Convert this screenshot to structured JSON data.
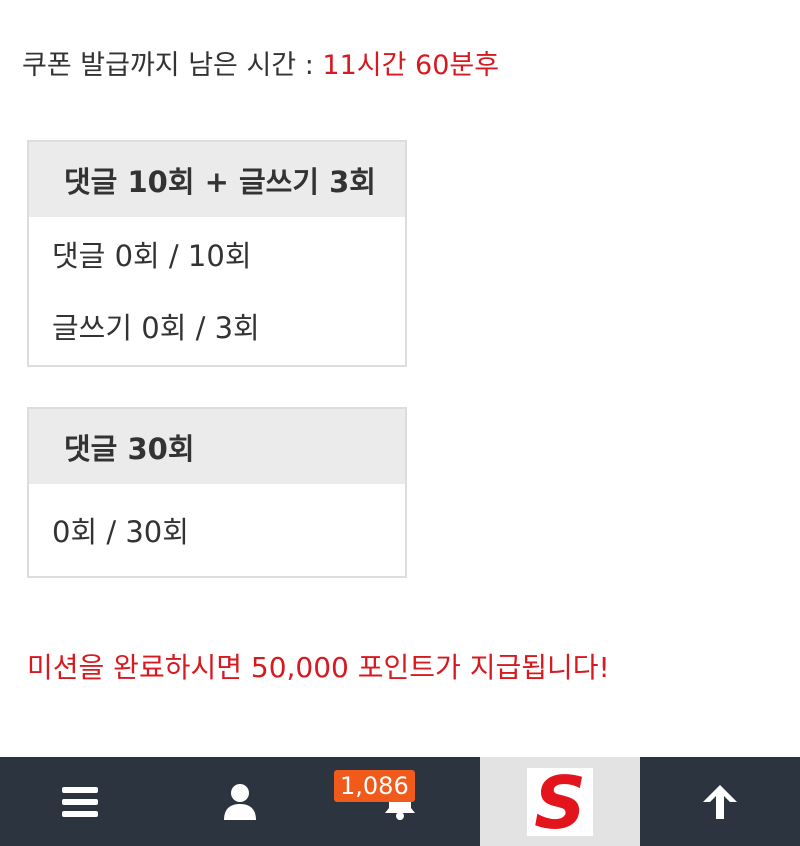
{
  "timer": {
    "label": "쿠폰 발급까지 남은 시간 : ",
    "value": "11시간 60분후"
  },
  "missions": [
    {
      "title": "댓글 10회 + 글쓰기 3회",
      "rows": [
        "댓글 0회 / 10회",
        "글쓰기 0회 / 3회"
      ]
    },
    {
      "title": "댓글 30회",
      "rows": [
        "0회 / 30회"
      ]
    }
  ],
  "notice": "미션을 완료하시면 50,000 포인트가 지급됩니다!",
  "nav": {
    "items": [
      {
        "icon": "menu-icon"
      },
      {
        "icon": "user-icon"
      },
      {
        "icon": "bell-icon",
        "badge": "1,086"
      },
      {
        "icon": "site-logo"
      },
      {
        "icon": "arrow-up-icon"
      }
    ],
    "logo_letter": "S"
  },
  "colors": {
    "accent_red": "#d71920",
    "nav_bg": "#2c3440",
    "badge_bg": "#f05a1a",
    "box_header_bg": "#ebebeb"
  }
}
